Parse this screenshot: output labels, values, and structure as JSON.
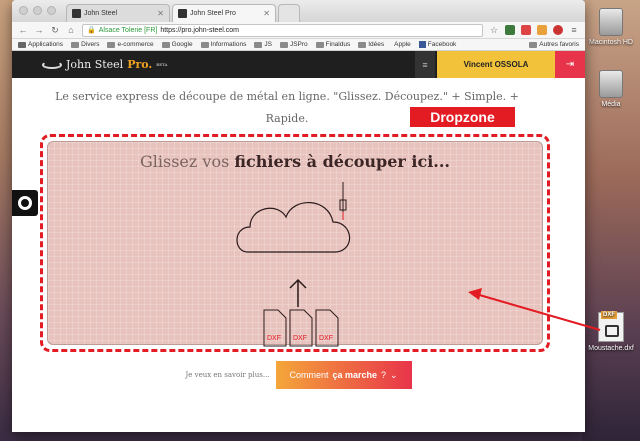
{
  "desktop": {
    "icons": [
      {
        "name": "hd-icon",
        "label": "Macintosh HD"
      },
      {
        "name": "media-icon",
        "label": "Média"
      },
      {
        "name": "dxf-file-icon",
        "label": "Moustache.dxf",
        "badge": "DXF"
      }
    ]
  },
  "browser": {
    "tabs": [
      {
        "label": "John Steel",
        "active": false
      },
      {
        "label": "John Steel Pro",
        "active": true
      }
    ],
    "omnibox": {
      "ev_label": "Alsace Tolerie [FR]",
      "url": "https://pro.john-steel.com"
    },
    "bookmarks": [
      "Applications",
      "Divers",
      "e-commerce",
      "Google",
      "Informations",
      "JS",
      "JSPro",
      "Finaldus",
      "Idées",
      "Apple",
      "Facebook"
    ],
    "bookmarks_right": "Autres favoris"
  },
  "site": {
    "logo_text": "John Steel",
    "logo_pro": "Pro.",
    "logo_beta": "BETA",
    "user_name": "Vincent OSSOLA",
    "menu_icon": "menu-icon",
    "logout_icon": "logout-icon",
    "tagline": "Le service express de découpe de métal en ligne. \"Glissez. Découpez.\" + Simple. + Rapide.",
    "dropzone_label": "Dropzone",
    "dropzone_title_plain": "Glissez vos",
    "dropzone_title_bold": "fichiers à découper ici...",
    "file_labels": [
      "DXF",
      "DXF",
      "DXF"
    ],
    "learn_more": "Je veux en savoir plus...",
    "how_button_plain": "Comment",
    "how_button_bold": "ça marche",
    "how_button_suffix": "?"
  },
  "colors": {
    "accent_red": "#e31b23",
    "user_yellow": "#f2c23a",
    "logout_red": "#e8344a",
    "dropzone_fill": "#e8c3be"
  }
}
